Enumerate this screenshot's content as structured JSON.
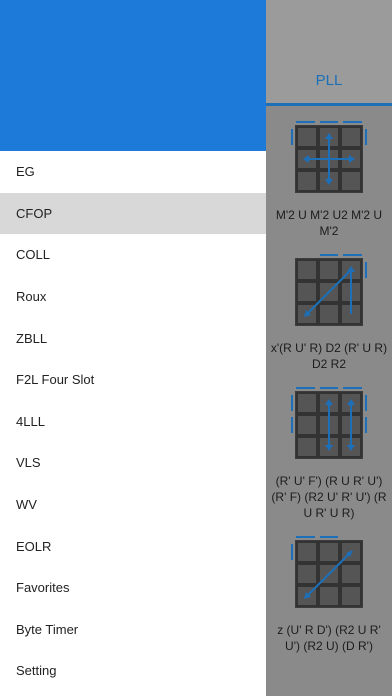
{
  "drawer": {
    "header_color": "#1e7ad8",
    "items": [
      {
        "label": "EG",
        "selected": false
      },
      {
        "label": "CFOP",
        "selected": true
      },
      {
        "label": "COLL",
        "selected": false
      },
      {
        "label": "Roux",
        "selected": false
      },
      {
        "label": "ZBLL",
        "selected": false
      },
      {
        "label": "F2L Four Slot",
        "selected": false
      },
      {
        "label": "4LLL",
        "selected": false
      },
      {
        "label": "VLS",
        "selected": false
      },
      {
        "label": "WV",
        "selected": false
      },
      {
        "label": "EOLR",
        "selected": false
      },
      {
        "label": "Favorites",
        "selected": false
      },
      {
        "label": "Byte Timer",
        "selected": false
      },
      {
        "label": "Setting",
        "selected": false
      }
    ]
  },
  "content": {
    "tab": {
      "label": "PLL"
    },
    "accent_color": "#1d6fb8",
    "cases": [
      {
        "algorithm": "M'2 U M'2 U2 M'2 U M'2",
        "diagram": "ua-perm"
      },
      {
        "algorithm": "x'(R U' R) D2 (R' U R) D2 R2",
        "diagram": "aa-perm"
      },
      {
        "algorithm": "(R' U' F') (R U R' U') (R' F) (R2 U' R' U') (R U R' U R)",
        "diagram": "h-perm"
      },
      {
        "algorithm": "z (U' R D') (R2 U R' U') (R2 U) (D R')",
        "diagram": "diag-perm"
      }
    ]
  }
}
